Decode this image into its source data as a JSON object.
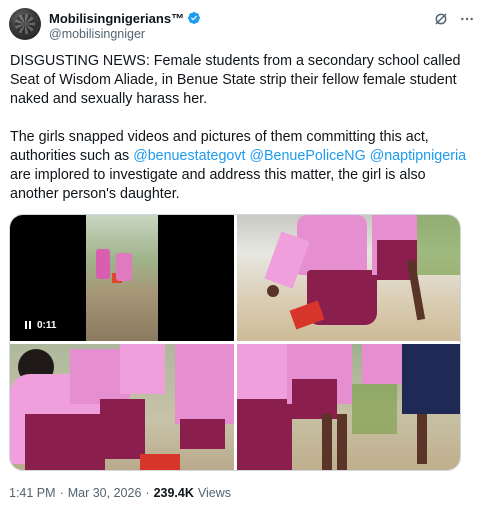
{
  "author": {
    "display_name": "MobilisingnigeriansTM",
    "display_name_text": "Mobilisingnigerians™",
    "handle": "@mobilisingniger",
    "verified_color": "#1d9bf0"
  },
  "header_icons": {
    "grok": "grok-icon",
    "more": "more-icon"
  },
  "tweet": {
    "paragraph1": "DISGUSTING NEWS: Female students from a secondary school called Seat of Wisdom Aliade, in Benue State strip their fellow female student naked and sexually harass her.",
    "paragraph2_before": "The girls snapped videos and pictures of them committing this act, authorities such as ",
    "mention1": "@benuestategovt",
    "mention2": "@BenuePoliceNG",
    "mention3": "@naptipnigeria",
    "paragraph2_after": " are implored to investigate and address this matter, the girl is also another person's daughter.",
    "link_color": "#1d9bf0"
  },
  "media": {
    "video_time": "0:11",
    "video_icon": "pause-icon"
  },
  "meta": {
    "time": "1:41 PM",
    "separator": "·",
    "date": "Mar 30, 2026",
    "separator2": "·",
    "views_count": "239.4K",
    "views_label": "Views"
  }
}
